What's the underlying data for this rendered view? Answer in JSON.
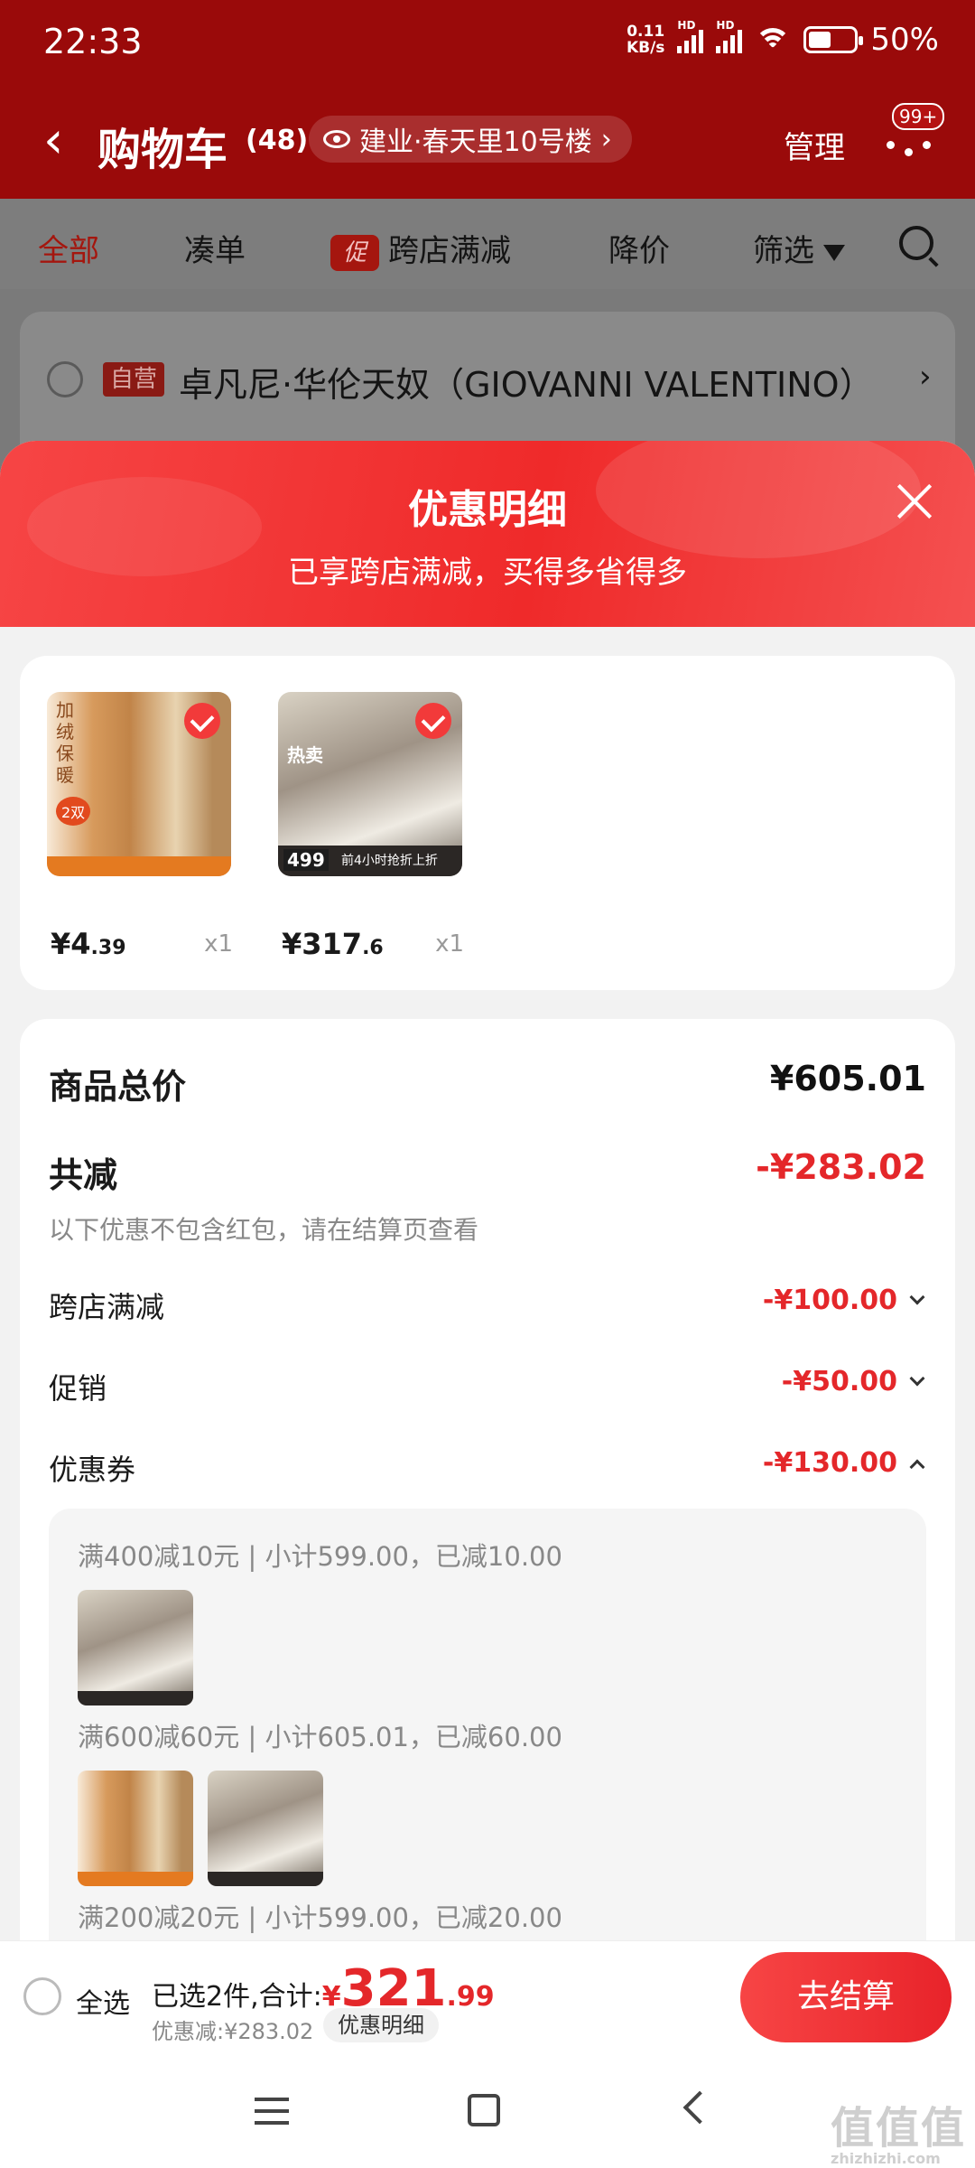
{
  "status_bar": {
    "time": "22:33",
    "net_speed_value": "0.11",
    "net_speed_unit": "KB/s",
    "signal_1_label": "HD",
    "signal_2_label": "HD",
    "battery_percent": "50%",
    "battery_level": 0.5
  },
  "header": {
    "back_glyph": "‹",
    "title": "购物车",
    "count": "(48)",
    "address": "建业·春天里10号楼",
    "address_chevron": "›",
    "manage_label": "管理",
    "message_badge": "99+"
  },
  "tabs": [
    {
      "label": "全部"
    },
    {
      "label": "凑单"
    },
    {
      "label": "跨店满减",
      "tag": "促"
    },
    {
      "label": "降价"
    },
    {
      "label": "筛选"
    }
  ],
  "background_store": {
    "tag": "自营",
    "name": "卓凡尼·华伦天奴（GIOVANNI VALENTINO）",
    "chevron": "›"
  },
  "sheet": {
    "title": "优惠明细",
    "subtitle": "已享跨店满减，买得多省得多",
    "products": [
      {
        "thumb_label": "加绒保暖",
        "thumb_badge": "2双",
        "price_symbol": "¥",
        "price_int": "4",
        "price_dec": ".39",
        "qty": "x1"
      },
      {
        "thumb_label": "热卖",
        "thumb_badge": "499",
        "thumb_banner": "前4小时抢折上折",
        "price_symbol": "¥",
        "price_int": "317",
        "price_dec": ".6",
        "qty": "x1"
      }
    ],
    "total_label": "商品总价",
    "total_value": "¥605.01",
    "reduce_label": "共减",
    "reduce_value": "-¥283.02",
    "reduce_note": "以下优惠不包含红包，请在结算页查看",
    "items": [
      {
        "label": "跨店满减",
        "value": "-¥100.00",
        "expanded": false
      },
      {
        "label": "促销",
        "value": "-¥50.00",
        "expanded": false
      },
      {
        "label": "优惠券",
        "value": "-¥130.00",
        "expanded": true
      }
    ],
    "coupons": [
      {
        "text": "满400减10元 | 小计599.00，已减10.00"
      },
      {
        "text": "满600减60元 | 小计605.01，已减60.00"
      },
      {
        "text": "满200减20元 | 小计599.00，已减20.00"
      }
    ]
  },
  "bottom_bar": {
    "select_all": "全选",
    "selected_prefix": "已选2件,合计:",
    "currency": "¥",
    "total_int": "321",
    "total_dec": ".99",
    "discount_line": "优惠减:¥283.02",
    "discount_detail_button": "优惠明细",
    "checkout": "去结算"
  },
  "watermark": {
    "text": "值值值",
    "domain": "zhizhizhi.com"
  },
  "colors": {
    "brand_red": "#e4272a",
    "header_bg": "#9a0a0a"
  }
}
